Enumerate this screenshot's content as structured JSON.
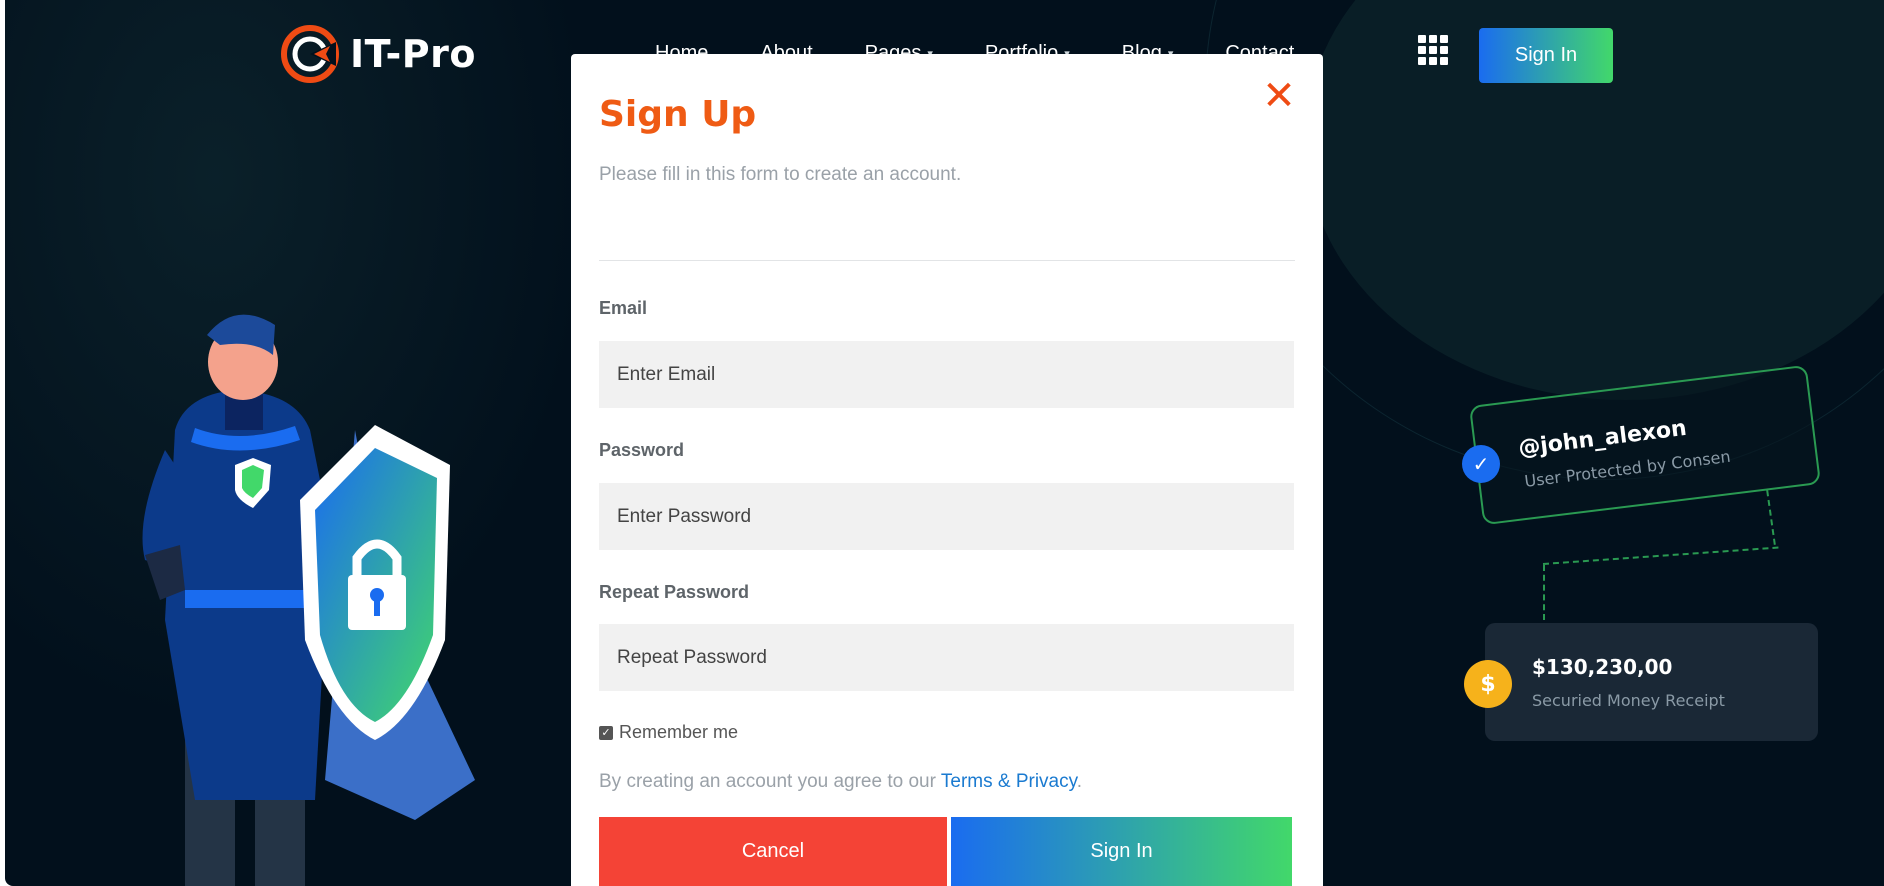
{
  "brand": {
    "name": "IT-Pro"
  },
  "nav": {
    "items": [
      {
        "label": "Home",
        "has_dropdown": false
      },
      {
        "label": "About",
        "has_dropdown": false
      },
      {
        "label": "Pages",
        "has_dropdown": true
      },
      {
        "label": "Portfolio",
        "has_dropdown": true
      },
      {
        "label": "Blog",
        "has_dropdown": true
      },
      {
        "label": "Contact",
        "has_dropdown": false
      }
    ],
    "apps_icon": "grid-icon",
    "signin_label": "Sign In"
  },
  "illustration": {
    "user_card": {
      "handle": "@john_alexon",
      "subtitle": "User Protected by Consen"
    },
    "money_card": {
      "amount": "$130,230,00",
      "subtitle": "Securied Money Receipt",
      "badge": "$"
    }
  },
  "modal": {
    "title": "Sign Up",
    "subtitle": "Please fill in this form to create an account.",
    "fields": {
      "email": {
        "label": "Email",
        "placeholder": "Enter Email",
        "value": ""
      },
      "password": {
        "label": "Password",
        "placeholder": "Enter Password",
        "value": ""
      },
      "repeat_password": {
        "label": "Repeat Password",
        "placeholder": "Repeat Password",
        "value": ""
      }
    },
    "remember": {
      "label": "Remember me",
      "checked": true
    },
    "agreement": {
      "prefix": "By creating an account you agree to our ",
      "link": "Terms & Privacy",
      "suffix": "."
    },
    "cancel_label": "Cancel",
    "signin_label": "Sign In"
  },
  "colors": {
    "background": "#02101c",
    "accent_orange": "#ef5b14",
    "cancel_red": "#f44336",
    "gradient_start": "#1a6cf0",
    "gradient_end": "#42d86a",
    "link_blue": "#1a7ad0"
  }
}
